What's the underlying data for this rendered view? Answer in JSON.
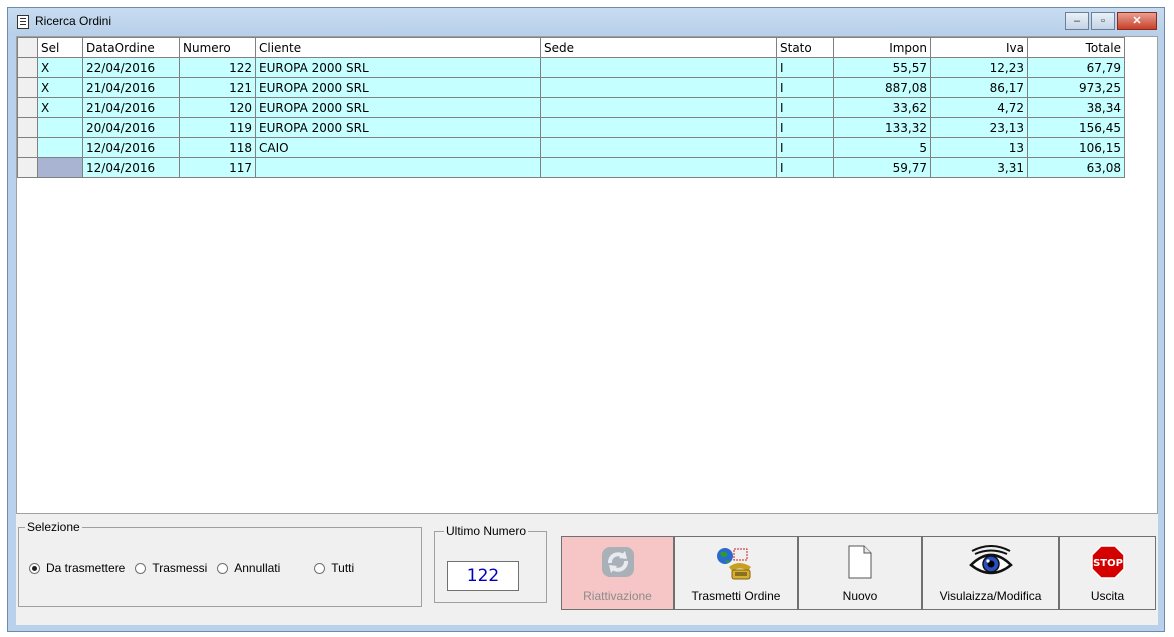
{
  "window": {
    "title": "Ricerca Ordini",
    "buttons": {
      "minimize": "–",
      "maximize": "▫",
      "close": "✕"
    }
  },
  "grid": {
    "columns": [
      "Sel",
      "DataOrdine",
      "Numero",
      "Cliente",
      "Sede",
      "Stato",
      "Impon",
      "Iva",
      "Totale"
    ],
    "rows": [
      {
        "sel": "X",
        "data": "22/04/2016",
        "numero": "122",
        "cliente": "EUROPA 2000 SRL",
        "sede": "",
        "stato": "I",
        "impon": "55,57",
        "iva": "12,23",
        "totale": "67,79"
      },
      {
        "sel": "X",
        "data": "21/04/2016",
        "numero": "121",
        "cliente": "EUROPA 2000 SRL",
        "sede": "",
        "stato": "I",
        "impon": "887,08",
        "iva": "86,17",
        "totale": "973,25"
      },
      {
        "sel": "X",
        "data": "21/04/2016",
        "numero": "120",
        "cliente": "EUROPA 2000 SRL",
        "sede": "",
        "stato": "I",
        "impon": "33,62",
        "iva": "4,72",
        "totale": "38,34"
      },
      {
        "sel": "",
        "data": "20/04/2016",
        "numero": "119",
        "cliente": "EUROPA 2000 SRL",
        "sede": "",
        "stato": "I",
        "impon": "133,32",
        "iva": "23,13",
        "totale": "156,45"
      },
      {
        "sel": "",
        "data": "12/04/2016",
        "numero": "118",
        "cliente": "CAIO",
        "sede": "",
        "stato": "I",
        "impon": "5",
        "iva": "13",
        "totale": "106,15"
      },
      {
        "sel": "",
        "data": "12/04/2016",
        "numero": "117",
        "cliente": "",
        "sede": "",
        "stato": "I",
        "impon": "59,77",
        "iva": "3,31",
        "totale": "63,08"
      }
    ]
  },
  "selezione": {
    "label": "Selezione",
    "options": [
      {
        "label": "Da trasmettere",
        "checked": true
      },
      {
        "label": "Trasmessi",
        "checked": false
      },
      {
        "label": "Annullati",
        "checked": false
      },
      {
        "label": "Tutti",
        "checked": false
      }
    ]
  },
  "ultimo_numero": {
    "label": "Ultimo Numero",
    "value": "122"
  },
  "buttons": {
    "riattivazione": "Riattivazione",
    "trasmetti": "Trasmetti Ordine",
    "nuovo": "Nuovo",
    "visualizza": "Visulaizza/Modifica",
    "uscita": "Uscita",
    "stop_text": "STOP"
  },
  "colors": {
    "row_bg": "#c5ffff",
    "disabled_btn": "#f6c6c6",
    "stop_red": "#d40000",
    "number_blue": "#0000c0"
  }
}
